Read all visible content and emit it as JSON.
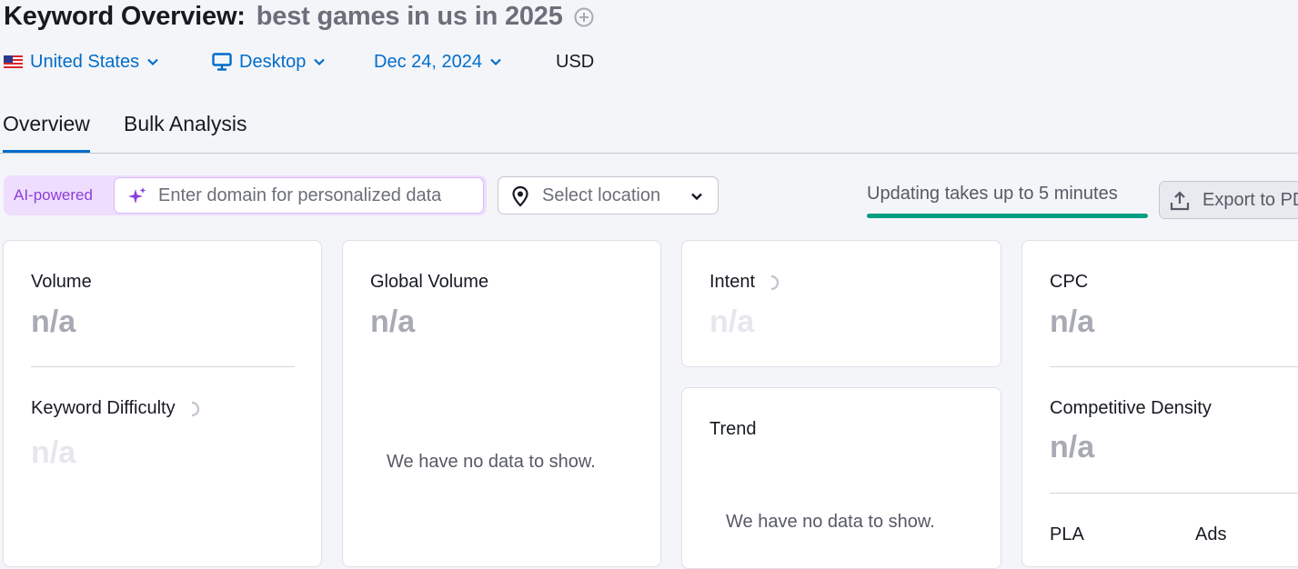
{
  "header": {
    "title": "Keyword Overview:",
    "keyword": "best games in us in 2025"
  },
  "filters": {
    "country": "United States",
    "device": "Desktop",
    "date": "Dec 24, 2024",
    "currency": "USD"
  },
  "tabs": [
    {
      "label": "Overview",
      "active": true
    },
    {
      "label": "Bulk Analysis",
      "active": false
    }
  ],
  "toolbar": {
    "ai_label": "AI-powered",
    "domain_placeholder": "Enter domain for personalized data",
    "location_placeholder": "Select location",
    "update_status": "Updating takes up to 5 minutes",
    "update_progress": 1.0,
    "export_label": "Export to PDF"
  },
  "cards": {
    "volume": {
      "label": "Volume",
      "value": "n/a"
    },
    "keyword_difficulty": {
      "label": "Keyword Difficulty",
      "value": "n/a"
    },
    "global_volume": {
      "label": "Global Volume",
      "value": "n/a",
      "empty": "We have no data to show."
    },
    "intent": {
      "label": "Intent",
      "value": "n/a"
    },
    "trend": {
      "label": "Trend",
      "empty": "We have no data to show."
    },
    "cpc": {
      "label": "CPC",
      "value": "n/a"
    },
    "competitive_density": {
      "label": "Competitive Density",
      "value": "n/a"
    },
    "pla": {
      "label": "PLA"
    },
    "ads": {
      "label": "Ads"
    }
  },
  "colors": {
    "accent_blue": "#006dca",
    "progress_green": "#009f81",
    "ai_purple": "#8b3fd9"
  },
  "icons": [
    "add-circle-icon",
    "us-flag-icon",
    "desktop-icon",
    "chevron-down-icon",
    "sparkle-icon",
    "location-pin-icon",
    "upload-icon",
    "loading-spinner-icon"
  ]
}
